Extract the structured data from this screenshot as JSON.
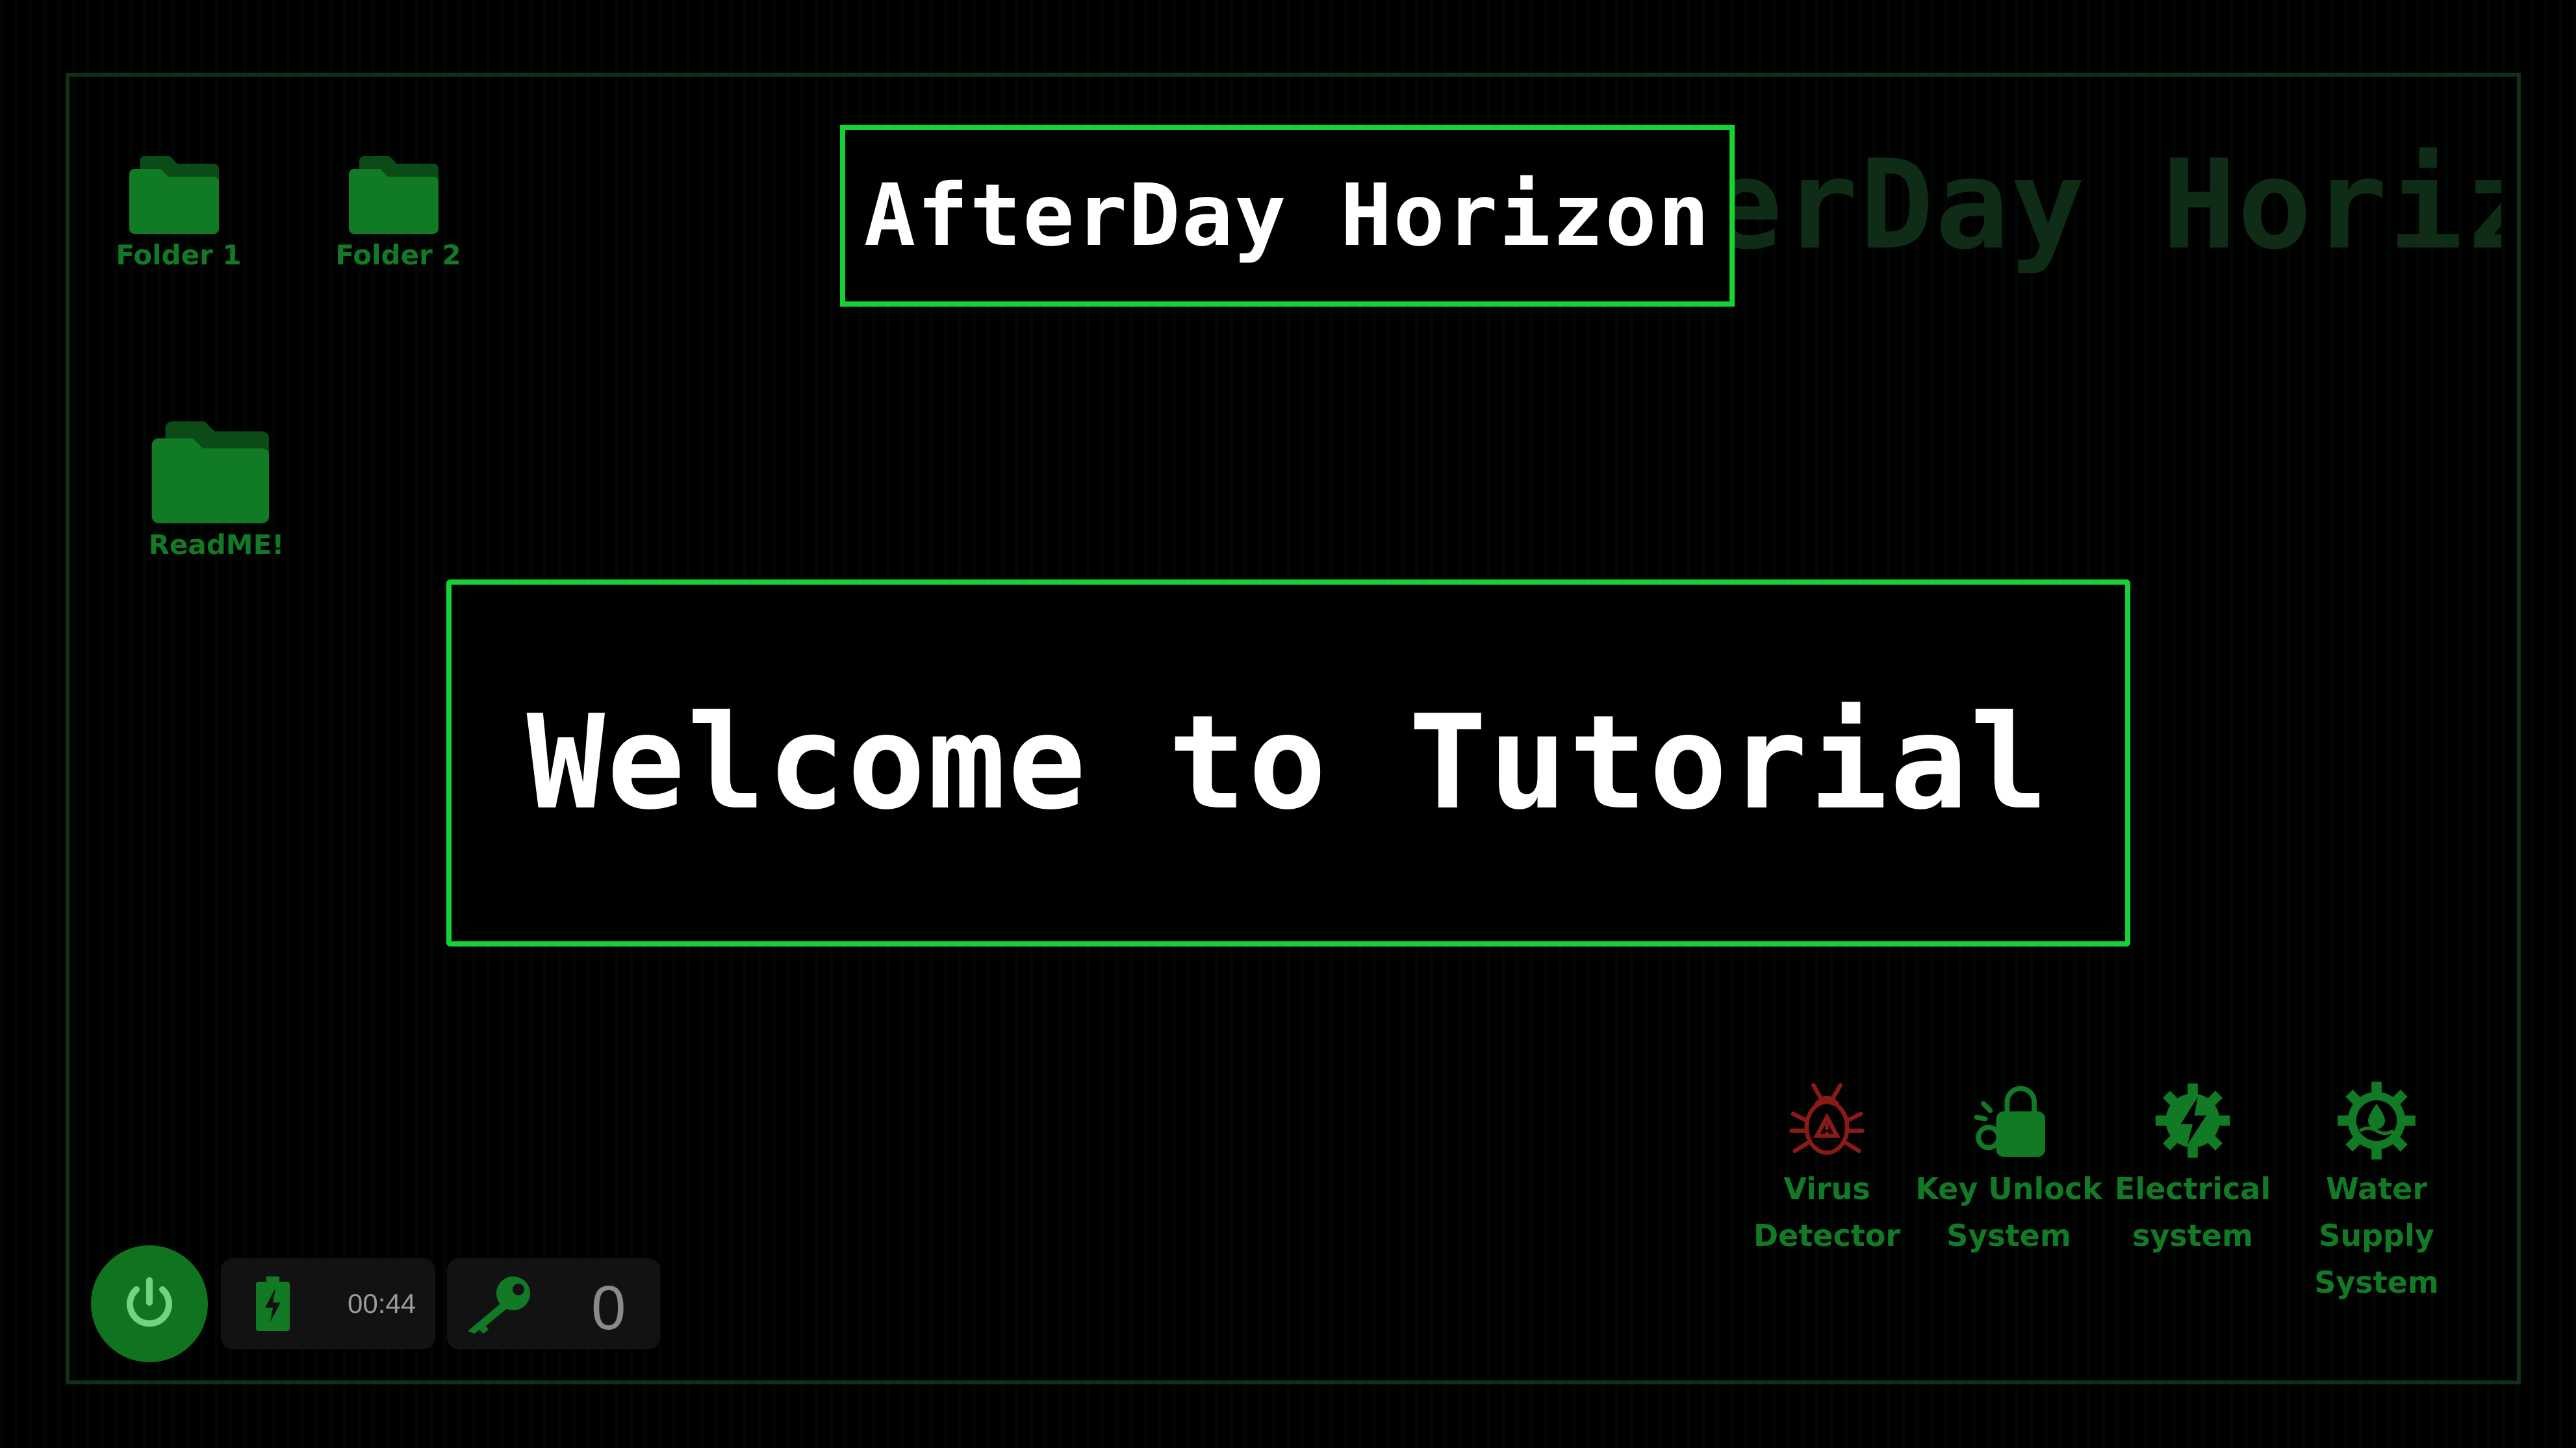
{
  "background_title": "AfterDay Horizon",
  "title": "AfterDay Horizon",
  "welcome": "Welcome to Tutorial",
  "desktop": {
    "folders": [
      {
        "label": "Folder 1",
        "icon": "folder-icon"
      },
      {
        "label": "Folder 2",
        "icon": "folder-icon"
      },
      {
        "label": "ReadME!",
        "icon": "folder-icon"
      }
    ]
  },
  "systems": [
    {
      "label_lines": [
        "Virus",
        "Detector"
      ],
      "icon": "virus-icon",
      "color": "#8a1a16"
    },
    {
      "label_lines": [
        "Key Unlock",
        "System"
      ],
      "icon": "key-unlock-icon",
      "color": "#127a25"
    },
    {
      "label_lines": [
        "Electrical",
        "system"
      ],
      "icon": "electrical-gear-icon",
      "color": "#127a25"
    },
    {
      "label_lines": [
        "Water",
        "Supply",
        "System"
      ],
      "icon": "water-gear-icon",
      "color": "#127a25"
    }
  ],
  "hud": {
    "timer": "00:44",
    "battery_icon": "battery-charging-icon",
    "key_icon": "key-icon",
    "keys_count": "0",
    "power_icon": "power-icon"
  },
  "colors": {
    "accent": "#16d334",
    "dim_green": "#127a25",
    "danger": "#8a1a16",
    "background": "#000000"
  }
}
